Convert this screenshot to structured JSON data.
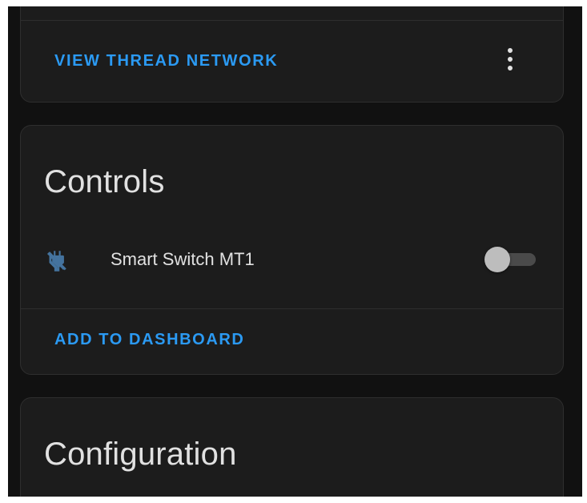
{
  "thread_card": {
    "action_label": "VIEW THREAD NETWORK",
    "menu_icon": "dots-vertical-icon"
  },
  "controls_card": {
    "title": "Controls",
    "entities": [
      {
        "name": "Smart Switch MT1",
        "icon": "power-plug-off-icon",
        "icon_color": "#44739e",
        "state": "off"
      }
    ],
    "action_label": "ADD TO DASHBOARD"
  },
  "configuration_card": {
    "title": "Configuration"
  },
  "theme": {
    "background": "#111111",
    "card_background": "#1c1c1c",
    "primary": "#2b9af3",
    "text": "#e1e1e1"
  }
}
